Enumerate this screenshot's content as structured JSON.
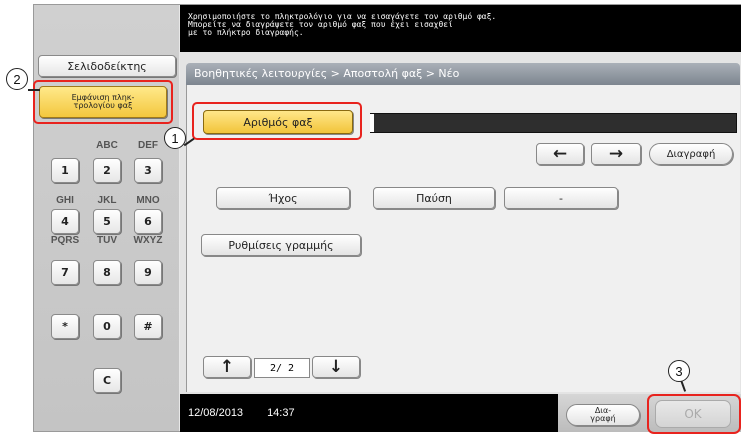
{
  "message": "Χρησιμοποιήστε το πληκτρολόγιο για να εισαγάγετε τον αριθμό φαξ.\nΜπορείτε να διαγράψετε τον αριθμό φαξ που έχει εισαχθεί\nμε το πλήκτρο διαγραφής.",
  "left_panel": {
    "index_label": "Σελιδοδείκτης",
    "keyboard_label_line1": "Εμφάνιση πληκ-",
    "keyboard_label_line2": "τρολογίου φαξ",
    "keypad": {
      "row1_letters": [
        "",
        "ABC",
        "DEF"
      ],
      "row1_keys": [
        "1",
        "2",
        "3"
      ],
      "row2_letters": [
        "GHI",
        "JKL",
        "MNO"
      ],
      "row2_keys": [
        "4",
        "5",
        "6"
      ],
      "row3_letters": [
        "PQRS",
        "TUV",
        "WXYZ"
      ],
      "row3_keys": [
        "7",
        "8",
        "9"
      ],
      "row4_keys": [
        "*",
        "0",
        "#"
      ],
      "clear_key": "C"
    }
  },
  "breadcrumb": "Βοηθητικές λειτουργίες > Αποστολή φαξ > Νέο",
  "main": {
    "fax_number_label": "Αριθμός φαξ",
    "fax_number_value": "",
    "left_arrow": "←",
    "right_arrow": "→",
    "delete_label": "Διαγραφή",
    "tone_label": "Ήχος",
    "pause_label": "Παύση",
    "dash_label": "-",
    "line_settings_label": "Ρυθμίσεις γραμμής",
    "page_up": "↑",
    "page_indicator": "2/ 2",
    "page_down": "↓"
  },
  "status": {
    "date": "12/08/2013",
    "time": "14:37"
  },
  "bottom": {
    "clear_label_line1": "Δια-",
    "clear_label_line2": "γραφή",
    "ok_label": "OK"
  },
  "callouts": [
    "1",
    "2",
    "3"
  ],
  "colors": {
    "highlight": "#e8231e",
    "selected_button": "#f3c73e",
    "message_bg": "#000000"
  }
}
